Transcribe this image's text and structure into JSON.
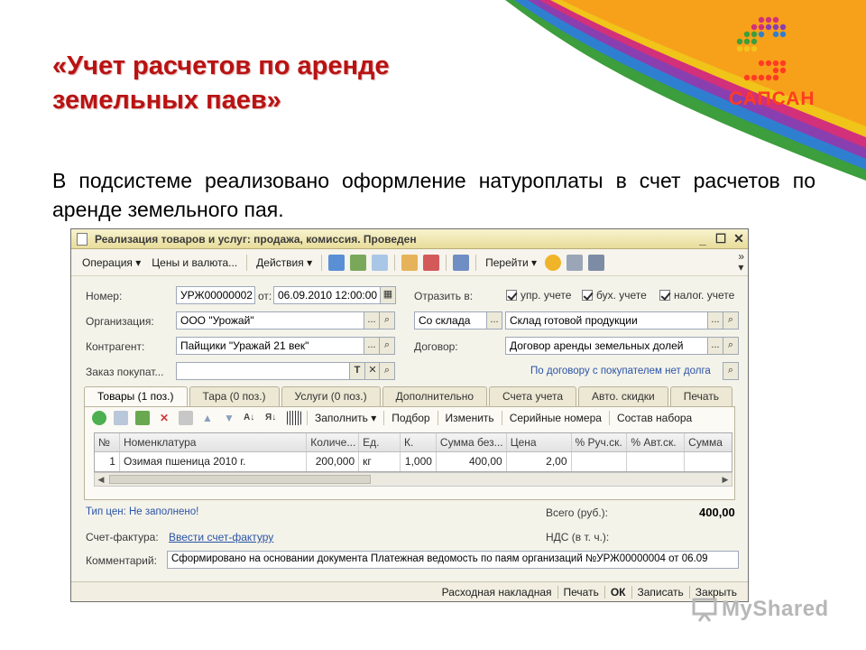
{
  "slide": {
    "title_line1": "«Учет расчетов по аренде",
    "title_line2": "земельных паев»",
    "body": "В подсистеме реализовано оформление натуроплаты в счет расчетов по аренде земельного пая."
  },
  "logo": {
    "text": "САПСАН"
  },
  "window": {
    "title": "Реализация товаров и услуг: продажа, комиссия. Проведен",
    "controls": {
      "minimize": "_",
      "maximize": "☐",
      "close": "✕"
    },
    "toolbar": {
      "operation": "Операция ▾",
      "prices": "Цены и валюта...",
      "actions": "Действия ▾",
      "goto": "Перейти ▾",
      "more": "»"
    },
    "form": {
      "number_label": "Номер:",
      "number_value": "УРЖ00000002",
      "from_label": "от:",
      "date_value": "06.09.2010 12:00:00",
      "reflect_label": "Отразить в:",
      "chk_upr": "упр. учете",
      "chk_buh": "бух. учете",
      "chk_nal": "налог. учете",
      "org_label": "Организация:",
      "org_value": "ООО \"Урожай\"",
      "stock_mode": "Со склада",
      "warehouse": "Склад готовой продукции",
      "contragent_label": "Контрагент:",
      "contragent_value": "Пайщики \"Уражай 21 век\"",
      "contract_label": "Договор:",
      "contract_value": "Договор аренды земельных долей",
      "order_label": "Заказ покупат...",
      "order_value": "",
      "contract_note": "По договору с покупателем нет долга"
    },
    "tabs": [
      "Товары (1 поз.)",
      "Тара (0 поз.)",
      "Услуги (0 поз.)",
      "Дополнительно",
      "Счета учета",
      "Авто. скидки",
      "Печать"
    ],
    "table_toolbar": {
      "fill": "Заполнить ▾",
      "pick": "Подбор",
      "change": "Изменить",
      "serials": "Серийные номера",
      "set": "Состав набора"
    },
    "table": {
      "columns": [
        "№",
        "Номенклатура",
        "Количе...",
        "Ед.",
        "К.",
        "Сумма без...",
        "Цена",
        "% Руч.ск.",
        "% Авт.ск.",
        "Сумма"
      ],
      "rows": [
        [
          "1",
          "Озимая пшеница 2010 г.",
          "200,000",
          "кг",
          "1,000",
          "400,00",
          "2,00",
          "",
          "",
          ""
        ]
      ]
    },
    "footer": {
      "price_type": "Тип цен: Не заполнено!",
      "total_label": "Всего (руб.):",
      "total_value": "400,00",
      "invoice_label": "Счет-фактура:",
      "invoice_link": "Ввести счет-фактуру",
      "vat_label": "НДС (в т. ч.):",
      "comment_label": "Комментарий:",
      "comment_value": "Сформировано на основании документа Платежная ведомость по паям организаций №УРЖ00000004 от 06.09"
    },
    "statusbar": {
      "waybill": "Расходная накладная",
      "print": "Печать",
      "ok": "ОК",
      "save": "Записать",
      "close": "Закрыть"
    }
  },
  "watermark": {
    "text": "MyShared"
  },
  "colors": {
    "title": "#b91212",
    "accent_orange": "#f7a11b",
    "logo_red": "#ff3c22",
    "window_bg": "#f4f3ea",
    "link": "#2a53a6"
  }
}
